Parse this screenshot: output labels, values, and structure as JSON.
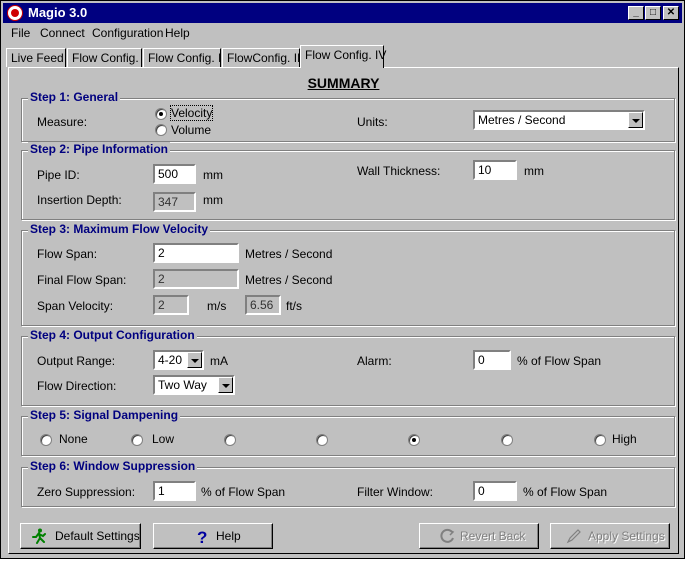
{
  "window": {
    "title": "Magio 3.0"
  },
  "menu": {
    "file": "File",
    "connect": "Connect",
    "configuration": "Configuration",
    "help": "Help"
  },
  "tabs": [
    "Live Feed",
    "Flow Config. I",
    "Flow Config. II",
    "FlowConfig. III",
    "Flow Config. IV"
  ],
  "active_tab": "Flow Config. IV",
  "heading": "SUMMARY",
  "step1": {
    "title": "Step 1: General",
    "measure_label": "Measure:",
    "measure_options": [
      "Velocity",
      "Volume"
    ],
    "measure_selected": "Velocity",
    "units_label": "Units:",
    "units_value": "Metres / Second"
  },
  "step2": {
    "title": "Step 2: Pipe Information",
    "pipe_id_label": "Pipe ID:",
    "pipe_id_value": "500",
    "pipe_id_unit": "mm",
    "insertion_label": "Insertion Depth:",
    "insertion_value": "347",
    "insertion_unit": "mm",
    "wall_label": "Wall Thickness:",
    "wall_value": "10",
    "wall_unit": "mm"
  },
  "step3": {
    "title": "Step 3: Maximum Flow Velocity",
    "flow_span_label": "Flow Span:",
    "flow_span_value": "2",
    "flow_span_unit": "Metres / Second",
    "final_span_label": "Final Flow Span:",
    "final_span_value": "2",
    "final_span_unit": "Metres / Second",
    "span_vel_label": "Span Velocity:",
    "span_vel_ms": "2",
    "span_vel_ms_unit": "m/s",
    "span_vel_fts": "6.56",
    "span_vel_fts_unit": "ft/s"
  },
  "step4": {
    "title": "Step 4: Output Configuration",
    "output_range_label": "Output Range:",
    "output_range_value": "4-20",
    "output_range_unit": "mA",
    "alarm_label": "Alarm:",
    "alarm_value": "0",
    "alarm_unit": "% of Flow Span",
    "flow_dir_label": "Flow Direction:",
    "flow_dir_value": "Two Way"
  },
  "step5": {
    "title": "Step 5: Signal Dampening",
    "low_end_label": "None",
    "second_label": "Low",
    "high_end_label": "High",
    "level_count": 7,
    "selected_index": 4
  },
  "step6": {
    "title": "Step 6: Window Suppression",
    "zero_label": "Zero Suppression:",
    "zero_value": "1",
    "zero_unit": "% of Flow Span",
    "filter_label": "Filter Window:",
    "filter_value": "0",
    "filter_unit": "% of Flow Span"
  },
  "buttons": {
    "default": "Default Settings",
    "help": "Help",
    "revert": "Revert Back",
    "apply": "Apply Settings"
  },
  "colors": {
    "titlebar": "#000080",
    "group_title": "#00007f",
    "face": "#c0c0c0"
  }
}
